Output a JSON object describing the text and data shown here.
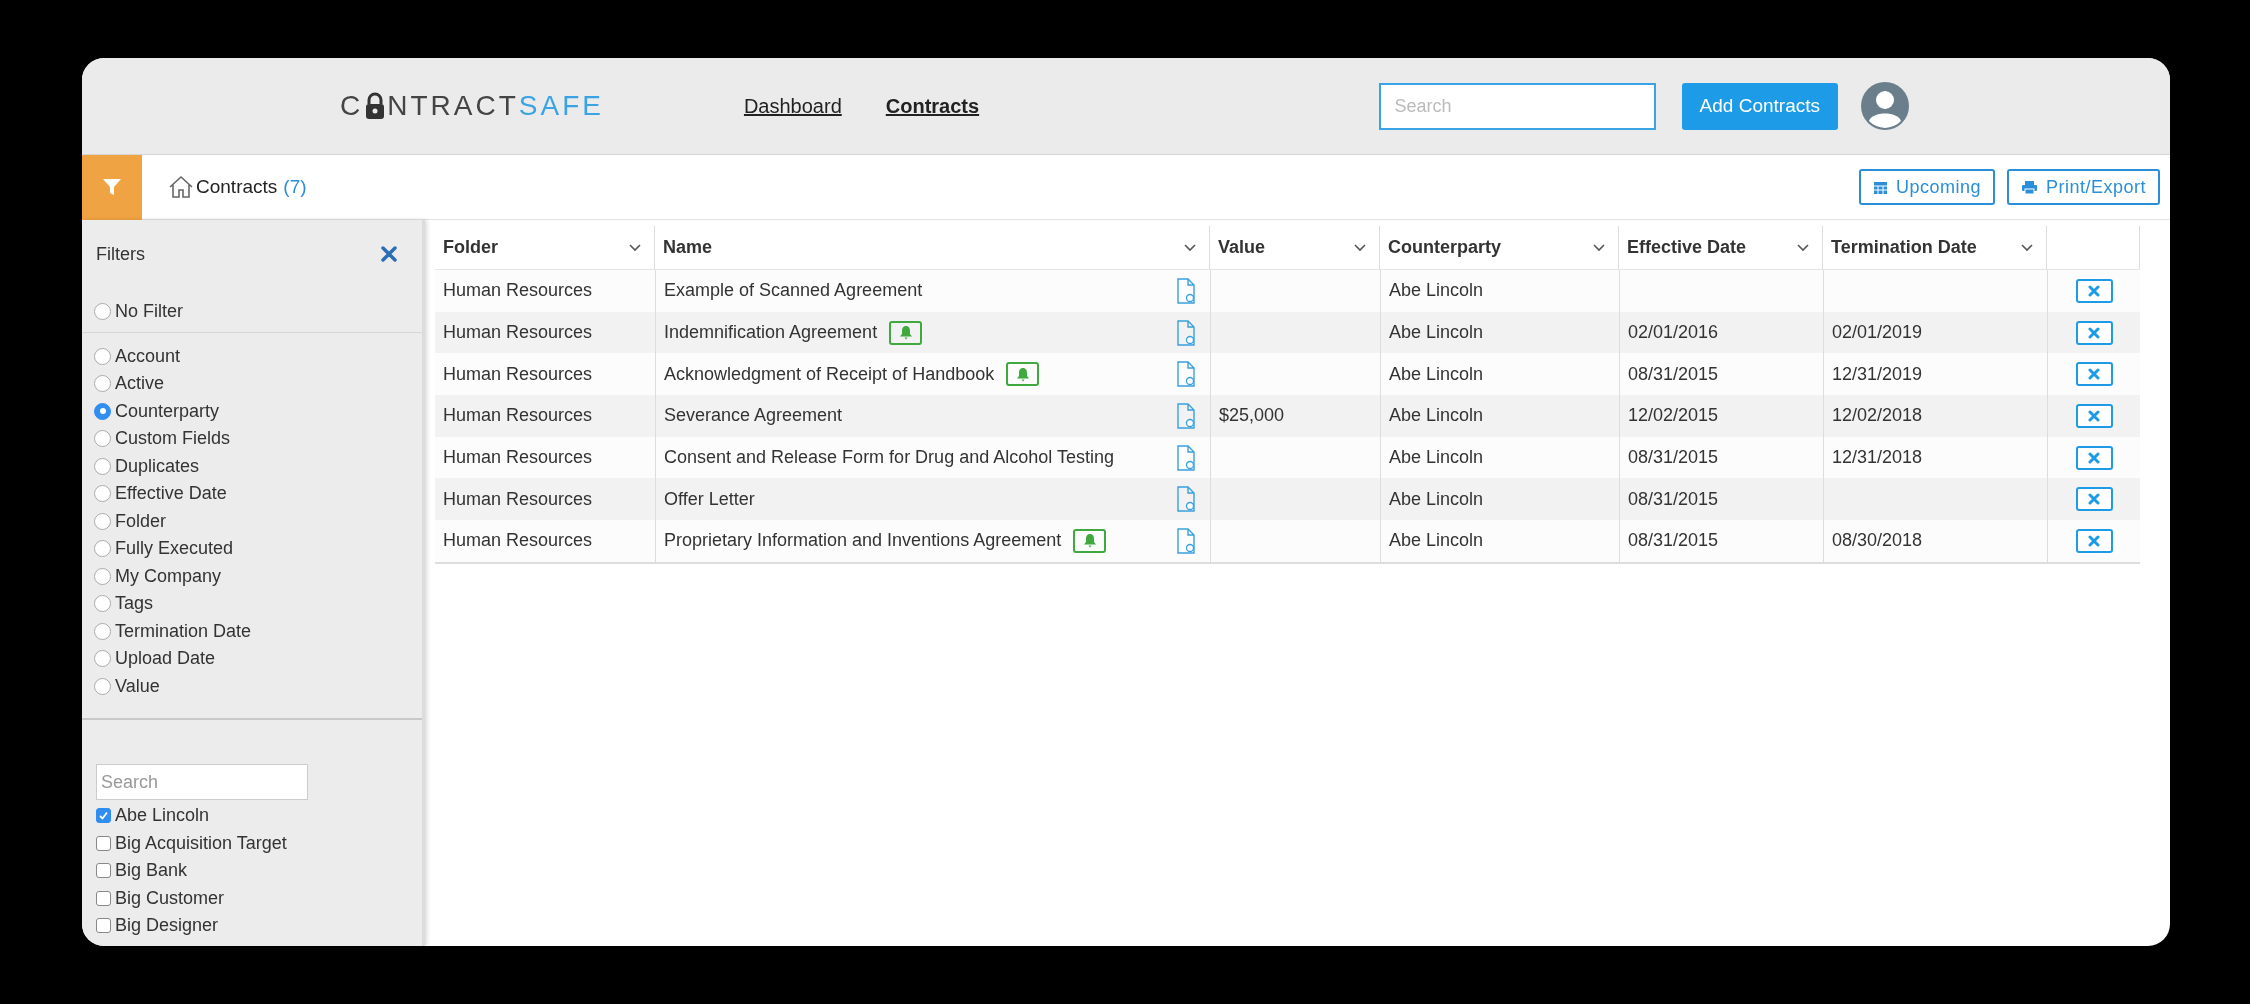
{
  "header": {
    "logo": {
      "before": "C",
      "after": "NTRACT",
      "accent": "SAFE"
    },
    "nav": [
      {
        "label": "Dashboard",
        "selected": false
      },
      {
        "label": "Contracts",
        "selected": true
      }
    ],
    "search": {
      "placeholder": "Search"
    },
    "add_button": "Add Contracts"
  },
  "toolbar": {
    "breadcrumb": "Contracts",
    "count": "(7)",
    "buttons": [
      "Upcoming",
      "Print/Export"
    ]
  },
  "filters": {
    "title": "Filters",
    "no_filter": {
      "label": "No Filter",
      "selected": false
    },
    "options": [
      {
        "label": "Account",
        "selected": false
      },
      {
        "label": "Active",
        "selected": false
      },
      {
        "label": "Counterparty",
        "selected": true
      },
      {
        "label": "Custom Fields",
        "selected": false
      },
      {
        "label": "Duplicates",
        "selected": false
      },
      {
        "label": "Effective Date",
        "selected": false
      },
      {
        "label": "Folder",
        "selected": false
      },
      {
        "label": "Fully Executed",
        "selected": false
      },
      {
        "label": "My Company",
        "selected": false
      },
      {
        "label": "Tags",
        "selected": false
      },
      {
        "label": "Termination Date",
        "selected": false
      },
      {
        "label": "Upload Date",
        "selected": false
      },
      {
        "label": "Value",
        "selected": false
      }
    ],
    "search": {
      "placeholder": "Search"
    },
    "values": [
      {
        "label": "Abe Lincoln",
        "checked": true
      },
      {
        "label": "Big Acquisition Target",
        "checked": false
      },
      {
        "label": "Big Bank",
        "checked": false
      },
      {
        "label": "Big Customer",
        "checked": false
      },
      {
        "label": "Big Designer",
        "checked": false
      }
    ]
  },
  "table": {
    "columns": [
      "Folder",
      "Name",
      "Value",
      "Counterparty",
      "Effective Date",
      "Termination Date"
    ],
    "rows": [
      {
        "folder": "Human Resources",
        "name": "Example of Scanned Agreement",
        "alert": false,
        "value": "",
        "counterparty": "Abe Lincoln",
        "effective": "",
        "termination": ""
      },
      {
        "folder": "Human Resources",
        "name": "Indemnification Agreement",
        "alert": true,
        "value": "",
        "counterparty": "Abe Lincoln",
        "effective": "02/01/2016",
        "termination": "02/01/2019"
      },
      {
        "folder": "Human Resources",
        "name": "Acknowledgment of Receipt of Handbook",
        "alert": true,
        "value": "",
        "counterparty": "Abe Lincoln",
        "effective": "08/31/2015",
        "termination": "12/31/2019"
      },
      {
        "folder": "Human Resources",
        "name": "Severance Agreement",
        "alert": false,
        "value": "$25,000",
        "counterparty": "Abe Lincoln",
        "effective": "12/02/2015",
        "termination": "12/02/2018"
      },
      {
        "folder": "Human Resources",
        "name": "Consent and Release Form for Drug and Alcohol Testing",
        "alert": false,
        "value": "",
        "counterparty": "Abe Lincoln",
        "effective": "08/31/2015",
        "termination": "12/31/2018"
      },
      {
        "folder": "Human Resources",
        "name": "Offer Letter",
        "alert": false,
        "value": "",
        "counterparty": "Abe Lincoln",
        "effective": "08/31/2015",
        "termination": ""
      },
      {
        "folder": "Human Resources",
        "name": "Proprietary Information and Inventions Agreement",
        "alert": true,
        "value": "",
        "counterparty": "Abe Lincoln",
        "effective": "08/31/2015",
        "termination": "08/30/2018"
      }
    ]
  }
}
